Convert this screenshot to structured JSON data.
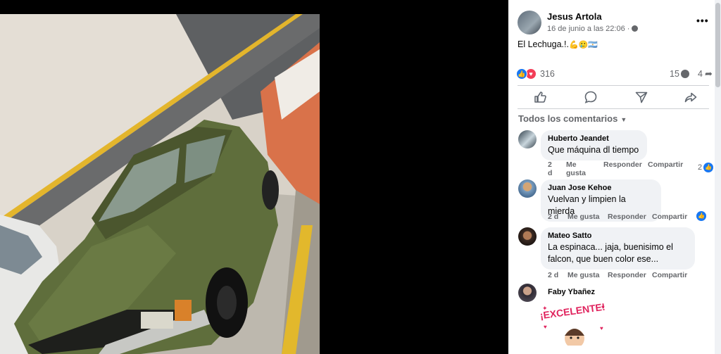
{
  "post": {
    "author": "Jesus Artola",
    "meta": "16 de junio a las 22:06 · ",
    "text": "El Lechuga.!.",
    "text_emoji": "💪🥲🇦🇷",
    "more_label": "•••"
  },
  "reactions": {
    "count": "316",
    "comments": "15",
    "shares": "4"
  },
  "actions": [
    {
      "name": "like",
      "icon": "thumb-up-icon"
    },
    {
      "name": "comment",
      "icon": "comment-icon"
    },
    {
      "name": "send",
      "icon": "send-icon"
    },
    {
      "name": "share",
      "icon": "share-icon"
    }
  ],
  "comments_sort": "Todos los comentarios",
  "comments": [
    {
      "name": "Huberto Jeandet",
      "text": "Que máquina dl tiempo",
      "time": "2 d",
      "like": "Me gusta",
      "reply": "Responder",
      "share": "Compartir",
      "likes": "2"
    },
    {
      "name": "Juan Jose Kehoe",
      "text": "Vuelvan y limpien la mierda",
      "time": "2 d",
      "like": "Me gusta",
      "reply": "Responder",
      "share": "Compartir",
      "likes": ""
    },
    {
      "name": "Mateo Satto",
      "text": "La espinaca... jaja, buenisimo el falcon, que buen color ese...",
      "time": "2 d",
      "like": "Me gusta",
      "reply": "Responder",
      "share": "Compartir",
      "likes": ""
    },
    {
      "name": "Faby Ybañez",
      "sticker_text": "¡EXCELENTE!"
    }
  ],
  "colors": {
    "accent": "#1877f2",
    "love": "#f33e58",
    "bubble": "#f0f2f5",
    "muted_text": "#65676b",
    "car_green": "#5f6e3c"
  }
}
